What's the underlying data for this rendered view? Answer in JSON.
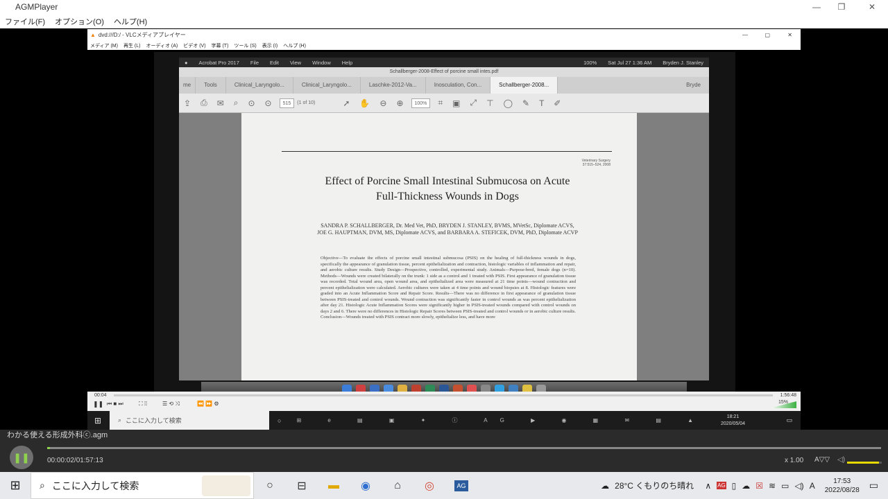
{
  "app": {
    "title": "AGMPlayer",
    "menu": [
      "ファイル(F)",
      "オプション(O)",
      "ヘルプ(H)"
    ]
  },
  "vlc": {
    "title": "dvd:///D:/ - VLCメディアプレイヤー",
    "menu": [
      "メディア (M)",
      "再生 (L)",
      "オーディオ (A)",
      "ビデオ (V)",
      "字幕 (T)",
      "ツール (S)",
      "表示 (I)",
      "ヘルプ (H)"
    ],
    "time_left": "00:04",
    "time_right": "1:56:48",
    "volume": "15%"
  },
  "mac": {
    "apple": "",
    "app": "Acrobat Pro 2017",
    "menu": [
      "File",
      "Edit",
      "View",
      "Window",
      "Help"
    ],
    "datetime": "Sat Jul 27  1:36 AM",
    "user": "Bryden J. Stanley",
    "battery": "100%"
  },
  "acrobat": {
    "doc_title": "Schallberger-2008-Effect of porcine small intes.pdf",
    "home": "me",
    "tools": "Tools",
    "tabs": [
      "Clinical_Laryngolo...",
      "Clinical_Laryngolo...",
      "Laschke-2012-Va...",
      "Inosculation, Con...",
      "Schallberger-2008..."
    ],
    "user": "Bryde",
    "page_num": "515",
    "page_of": "(1 of 10)",
    "zoom": "100%"
  },
  "paper": {
    "journal": "Veterinary Surgery 37:515–524, 2008",
    "title_l1": "Effect of Porcine Small Intestinal Submucosa on Acute",
    "title_l2": "Full-Thickness Wounds in Dogs",
    "authors_l1": "SANDRA P. SCHALLBERGER, Dr. Med Vet, PhD, BRYDEN J. STANLEY, BVMS, MVetSc, Diplomate ACVS,",
    "authors_l2": "JOE G. HAUPTMAN, DVM, MS, Diplomate ACVS, and BARBARA A. STEFICEK, DVM, PhD, Diplomate ACVP",
    "abstract": "Objective—To evaluate the effects of porcine small intestinal submucosa (PSIS) on the healing of full-thickness wounds in dogs, specifically the appearance of granulation tissue, percent epithelialization and contraction, histologic variables of inflammation and repair, and aerobic culture results. Study Design—Prospective, controlled, experimental study. Animals—Purpose-bred, female dogs (n=10). Methods—Wounds were created bilaterally on the trunk: 1 side as a control and 1 treated with PSIS. First appearance of granulation tissue was recorded. Total wound area, open wound area, and epithelialized area were measured at 21 time points—wound contraction and percent epithelialization were calculated. Aerobic cultures were taken at 4 time points and wound biopsies at 8. Histologic features were graded into an Acute Inflammation Score and Repair Score. Results—There was no difference in first appearance of granulation tissue between PSIS-treated and control wounds. Wound contraction was significantly faster in control wounds as was percent epithelialization after day 21. Histologic Acute Inflammation Scores were significantly higher in PSIS-treated wounds compared with control wounds on days 2 and 6. There were no differences in Histologic Repair Scores between PSIS-treated and control wounds or in aerobic culture results. Conclusion—Wounds treated with PSIS contract more slowly, epithelialize less, and have more"
  },
  "vlc_task": {
    "search": "ここに入力して検索",
    "time": "18:21",
    "date": "2020/05/04"
  },
  "player": {
    "filename": "わかる使える形成外科ⓒ.agm",
    "time": "00:00:02/01:57:13",
    "speed": "x 1.00",
    "ab": "A▽▽"
  },
  "taskbar": {
    "search": "ここに入力して検索",
    "weather": "28°C くもりのち晴れ",
    "time": "17:53",
    "date": "2022/08/28",
    "notif": ""
  }
}
